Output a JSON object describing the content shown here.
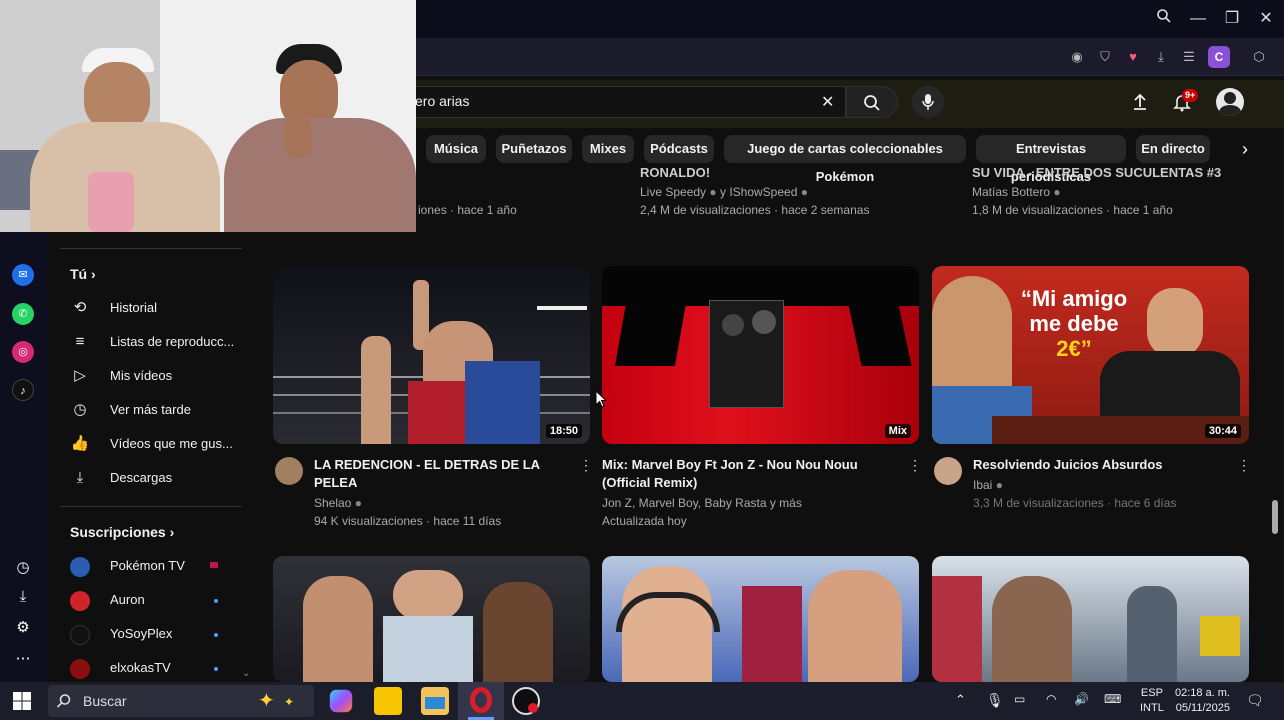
{
  "window": {
    "search_icon": "search-icon",
    "minimize": "—",
    "restore": "❐",
    "close": "✕"
  },
  "browser_toolbar": {
    "profile_letter": "C"
  },
  "youtube": {
    "search": {
      "value": "ero arias",
      "clear": "✕"
    },
    "notif_badge": "9+",
    "chips": [
      "Música",
      "Puñetazos",
      "Mixes",
      "Pódcasts",
      "Juego de cartas coleccionables Pokémon",
      "Entrevistas periodísticas",
      "En directo"
    ]
  },
  "top_row": [
    {
      "title": "RONALDO!",
      "channel": "Live Speedy",
      "channel2": "y IShowSpeed",
      "meta": "2,4 M de visualizaciones · hace 2 semanas"
    },
    {
      "title": "SU VIDA - ENTRE DOS SUCULENTAS #3",
      "channel": "Matías Bottero",
      "meta": "1,8 M de visualizaciones · hace 1 año"
    },
    {
      "meta": "iones · hace 1 año"
    }
  ],
  "sidebar": {
    "you_label": "Tú",
    "items": [
      {
        "label": "Historial",
        "icon": "history-icon",
        "glyph": "⟲"
      },
      {
        "label": "Listas de reproducc...",
        "icon": "playlist-icon",
        "glyph": "≡"
      },
      {
        "label": "Mis vídeos",
        "icon": "my-videos-icon",
        "glyph": "▷"
      },
      {
        "label": "Ver más tarde",
        "icon": "watch-later-icon",
        "glyph": "◷"
      },
      {
        "label": "Vídeos que me gus...",
        "icon": "liked-icon",
        "glyph": "👍"
      },
      {
        "label": "Descargas",
        "icon": "download-icon",
        "glyph": "⤓"
      }
    ],
    "subs_label": "Suscripciones",
    "subs": [
      {
        "name": "Pokémon TV",
        "color": "#2a5db0"
      },
      {
        "name": "Auron",
        "color": "#d0232a"
      },
      {
        "name": "YoSoyPlex",
        "color": "#111111"
      },
      {
        "name": "elxokasTV",
        "color": "#8a1010"
      }
    ]
  },
  "videos": [
    {
      "title1": "LA REDENCION - EL DETRAS DE LA",
      "title2": "PELEA",
      "channel": "Shelao",
      "meta": "94 K visualizaciones · hace 11 días",
      "duration": "18:50"
    },
    {
      "title1": "Mix: Marvel Boy Ft Jon Z - Nou Nou Nouu",
      "title2": "(Official Remix)",
      "channel": "Jon Z, Marvel Boy, Baby Rasta y más",
      "meta": "Actualizada hoy",
      "duration": "Mix"
    },
    {
      "title1": "Resolviendo Juicios Absurdos",
      "title2": "",
      "channel": "Ibai",
      "meta": "3,3 M de visualizaciones · hace 6 días",
      "duration": "30:44",
      "overlay1": "“Mi amigo",
      "overlay2": "me debe",
      "overlay3": "2€”"
    }
  ],
  "taskbar": {
    "search_placeholder": "Buscar",
    "lang1": "ESP",
    "lang2": "INTL",
    "time": "02:18 a. m.",
    "date": "05/11/2025"
  }
}
